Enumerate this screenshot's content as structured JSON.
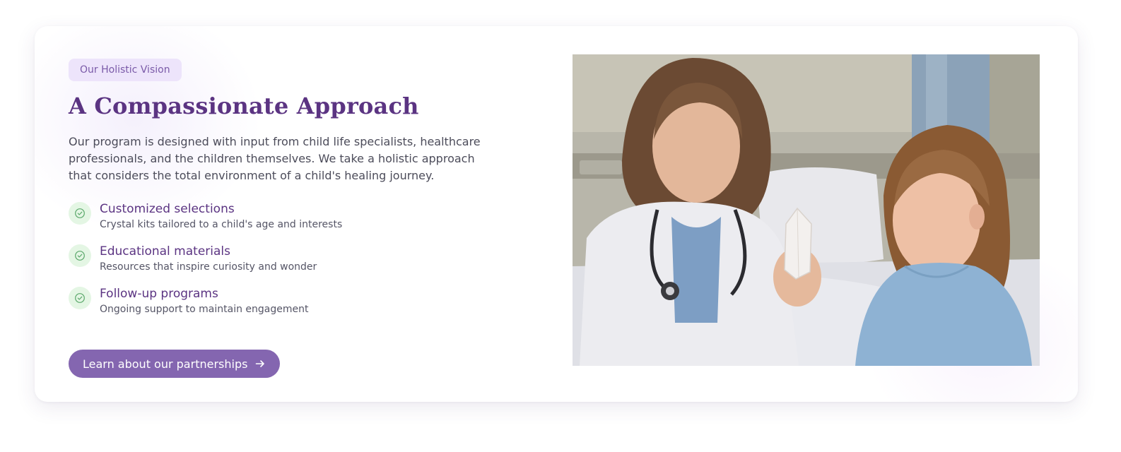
{
  "section": {
    "badge": "Our Holistic Vision",
    "title": "A Compassionate Approach",
    "description": "Our program is designed with input from child life specialists, healthcare professionals, and the children themselves. We take a holistic approach that considers the total environment of a child's healing journey.",
    "features": [
      {
        "title": "Customized selections",
        "subtitle": "Crystal kits tailored to a child's age and interests",
        "icon": "check-circle-icon"
      },
      {
        "title": "Educational materials",
        "subtitle": "Resources that inspire curiosity and wonder",
        "icon": "check-circle-icon"
      },
      {
        "title": "Follow-up programs",
        "subtitle": "Ongoing support to maintain engagement",
        "icon": "check-circle-icon"
      }
    ],
    "cta_label": "Learn about our partnerships",
    "cta_icon": "arrow-right-icon"
  },
  "image": {
    "alt": "Doctor showing a crystal to a young patient in a hospital bed"
  },
  "colors": {
    "accent": "#8466b0",
    "heading": "#5b3482",
    "badge_bg": "#ede4fb",
    "check_bg": "#e4f6e4",
    "check_stroke": "#5aa86a"
  }
}
